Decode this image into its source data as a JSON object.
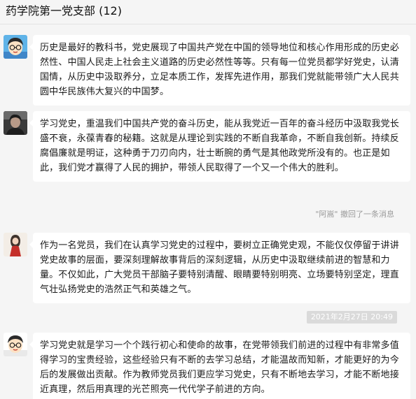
{
  "header": {
    "title": "药学院第一党支部 (12)"
  },
  "messages": [
    {
      "avatar_icon": "cartoon-boy-glasses-avatar-icon",
      "text": "历史是最好的教科书，党史展现了中国共产党在中国的领导地位和核心作用形成的历史必然性、中国人民走上社会主义道路的历史必然性等等。只有每一位党员都学好党史，认清国情，从历史中汲取养分，立足本质工作，发挥先进作用，那我们党就能带领广大人民共圆中华民族伟大复兴的中国梦。"
    },
    {
      "avatar_icon": "dark-portrait-avatar-icon",
      "text": "学习党史，重温我们中国共产党的奋斗历史，能从我党近一百年的奋斗经历中汲取我党长盛不衰，永葆青春的秘籍。这就是从理论到实践的不断自我革命，不断自我创新。持续反腐倡廉就是明证，这种勇于刀刃向内，壮士断腕的勇气是其他政党所没有的。也正是如此，我们党才赢得了人民的拥护，带领人民取得了一个又一个伟大的胜利。"
    },
    {
      "avatar_icon": "girl-red-dress-avatar-icon",
      "text": "作为一名党员，我们在认真学习党史的过程中，要树立正确党史观，不能仅仅停留于讲讲党史故事的层面，要深刻理解故事背后的深刻逻辑，从历史中汲取继续前进的智慧和力量。不仅如此，广大党员干部脑子要特别清醒、眼睛要特别明亮、立场要特别坚定，理直气壮弘扬党史的浩然正气和英雄之气。"
    },
    {
      "avatar_icon": "cartoon-boy-glasses-avatar-icon",
      "text": "学习党史就是学习一个个践行初心和使命的故事，在党带领我们前进的过程中有非常多值得学习的宝贵经验，这些经验只有不断的去学习总结，才能温故而知新，才能更好的为今后的发展做出贡献。作为教师党员我们更应学习党史，只有不断地去学习，才能不断地接近真理，然后用真理的光芒照亮一代代学子前进的方向。"
    }
  ],
  "system": {
    "recall_notice": "\"阿嵩\" 撤回了一条消息",
    "timestamp": "2021年2月27日 20:49"
  }
}
